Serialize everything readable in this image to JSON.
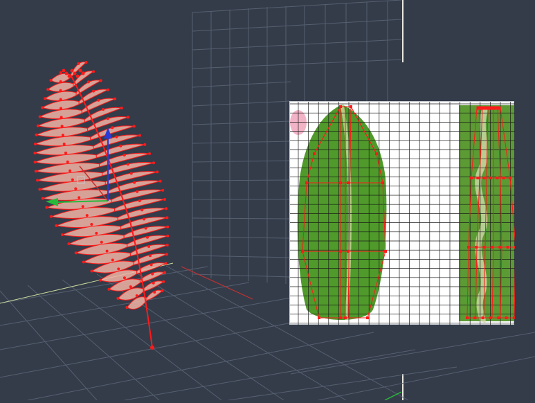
{
  "scene": {
    "background_color": "#343c4a",
    "grid_color": "#5a6474",
    "wireframe_color": "#ff1a1a",
    "leaf_fill_color": "#f3b3a3",
    "gizmo_colors": {
      "x": "#2ab83a",
      "y": "#2a3ad8",
      "z": "#d83030"
    },
    "objects": [
      "fern-frond-mesh",
      "transform-gizmo",
      "ground-grid",
      "back-wall-grid"
    ]
  },
  "uv_editor": {
    "background_color": "#ffffff",
    "grid_line_color": "#1a1a1a",
    "textures": [
      "leaf-texture",
      "stem-strip-texture"
    ],
    "leaf_color": "#4f9a2a",
    "strip_color": "#5c9a34"
  }
}
